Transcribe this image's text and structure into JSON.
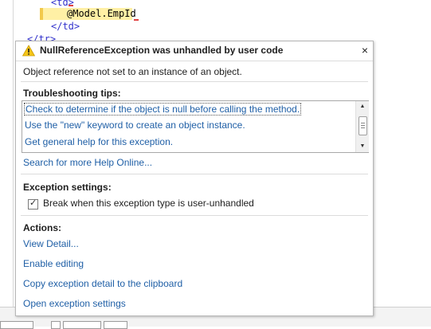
{
  "editor": {
    "line_td_open": "<td>",
    "line_model": "@Model.EmpId",
    "line_td_close": "</td>",
    "line_tr_close": "</tr>"
  },
  "popup": {
    "title": "NullReferenceException was unhandled by user code",
    "close_glyph": "×",
    "message": "Object reference not set to an instance of an object.",
    "troubleshooting_heading": "Troubleshooting tips:",
    "tips": [
      "Check to determine if the object is null before calling the method.",
      "Use the \"new\" keyword to create an object instance.",
      "Get general help for this exception."
    ],
    "search_online": "Search for more Help Online...",
    "exception_settings_heading": "Exception settings:",
    "break_checkbox_label": "Break when this exception type is user-unhandled",
    "break_checked": true,
    "actions_heading": "Actions:",
    "actions": [
      "View Detail...",
      "Enable editing",
      "Copy exception detail to the clipboard",
      "Open exception settings"
    ],
    "icons": {
      "warning": "warning-icon",
      "close": "close-icon",
      "scroll_up": "scroll-up-icon",
      "scroll_down": "scroll-down-icon",
      "checkbox_check": "check-icon"
    },
    "colors": {
      "link": "#1f5fa6",
      "warning_yellow": "#f5c518",
      "highlight": "#fff0a5"
    }
  }
}
